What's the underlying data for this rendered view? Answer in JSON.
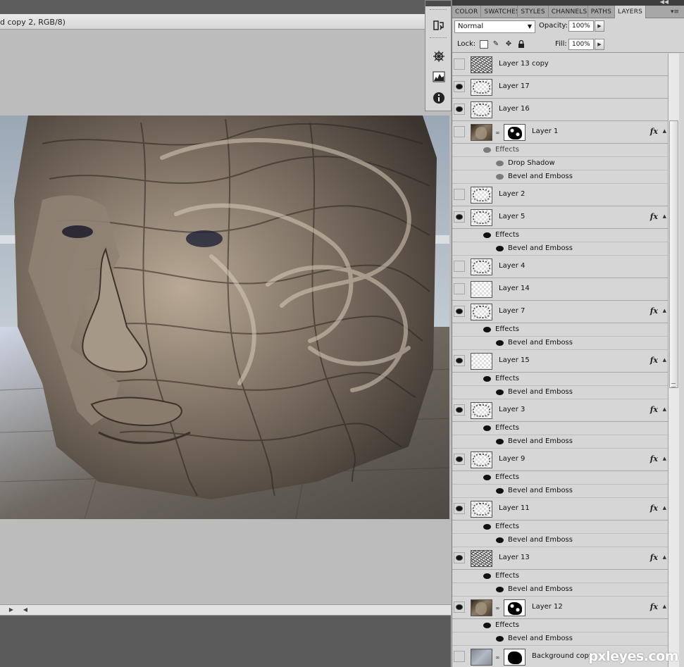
{
  "document": {
    "title": "d copy 2, RGB/8)",
    "artwork": "wireframe-face-sculpture"
  },
  "colors": {
    "panel_bg": "#d4d4d4",
    "canvas_bg": "#bcbcbc",
    "dark_chrome": "#3d3d3d"
  },
  "dock": {
    "icons": [
      "history-icon",
      "navigator-icon",
      "histogram-icon",
      "info-icon"
    ]
  },
  "panel": {
    "tabs": [
      {
        "label": "COLOR",
        "active": false
      },
      {
        "label": "SWATCHES",
        "active": false
      },
      {
        "label": "STYLES",
        "active": false
      },
      {
        "label": "CHANNELS",
        "active": false
      },
      {
        "label": "PATHS",
        "active": false
      },
      {
        "label": "LAYERS",
        "active": true
      }
    ],
    "blend_mode": "Normal",
    "opacity_label": "Opacity:",
    "opacity_value": "100%",
    "lock_label": "Lock:",
    "fill_label": "Fill:",
    "fill_value": "100%"
  },
  "layers": [
    {
      "name": "Layer 13 copy",
      "visible": false,
      "thumb": "dense",
      "mask": false,
      "fx": false,
      "effects": []
    },
    {
      "name": "Layer 17",
      "visible": true,
      "thumb": "sketch",
      "mask": false,
      "fx": false,
      "effects": []
    },
    {
      "name": "Layer 16",
      "visible": true,
      "thumb": "sketch",
      "mask": false,
      "fx": false,
      "effects": []
    },
    {
      "name": "Layer 1",
      "visible": false,
      "thumb": "photo",
      "mask": true,
      "fx": true,
      "effects_label": "Effects",
      "effects_dim": true,
      "effects": [
        "Drop Shadow",
        "Bevel and Emboss"
      ]
    },
    {
      "name": "Layer 2",
      "visible": false,
      "thumb": "sketch",
      "mask": false,
      "fx": false,
      "effects": []
    },
    {
      "name": "Layer 5",
      "visible": true,
      "thumb": "sketch",
      "mask": false,
      "fx": true,
      "effects_label": "Effects",
      "effects_dim": false,
      "effects": [
        "Bevel and Emboss"
      ]
    },
    {
      "name": "Layer 4",
      "visible": false,
      "thumb": "sketch",
      "mask": false,
      "fx": false,
      "effects": []
    },
    {
      "name": "Layer 14",
      "visible": false,
      "thumb": "checker",
      "mask": false,
      "fx": false,
      "effects": []
    },
    {
      "name": "Layer 7",
      "visible": true,
      "thumb": "sketch",
      "mask": false,
      "fx": true,
      "effects_label": "Effects",
      "effects_dim": false,
      "effects": [
        "Bevel and Emboss"
      ]
    },
    {
      "name": "Layer 15",
      "visible": true,
      "thumb": "checker",
      "mask": false,
      "fx": true,
      "effects_label": "Effects",
      "effects_dim": false,
      "effects": [
        "Bevel and Emboss"
      ]
    },
    {
      "name": "Layer 3",
      "visible": true,
      "thumb": "sketch",
      "mask": false,
      "fx": true,
      "effects_label": "Effects",
      "effects_dim": false,
      "effects": [
        "Bevel and Emboss"
      ]
    },
    {
      "name": "Layer 9",
      "visible": true,
      "thumb": "sketch",
      "mask": false,
      "fx": true,
      "effects_label": "Effects",
      "effects_dim": false,
      "effects": [
        "Bevel and Emboss"
      ]
    },
    {
      "name": "Layer 11",
      "visible": true,
      "thumb": "sketch",
      "mask": false,
      "fx": true,
      "effects_label": "Effects",
      "effects_dim": false,
      "effects": [
        "Bevel and Emboss"
      ]
    },
    {
      "name": "Layer 13",
      "visible": true,
      "thumb": "dense",
      "mask": false,
      "fx": true,
      "effects_label": "Effects",
      "effects_dim": false,
      "effects": [
        "Bevel and Emboss"
      ]
    },
    {
      "name": "Layer 12",
      "visible": true,
      "thumb": "photo",
      "mask": true,
      "fx": true,
      "effects_label": "Effects",
      "effects_dim": false,
      "effects": [
        "Bevel and Emboss"
      ]
    },
    {
      "name": "Background copy",
      "visible": false,
      "thumb": "bgphoto",
      "mask": true,
      "mask_style": "solid",
      "fx": false,
      "effects": []
    }
  ],
  "watermark": "pxleyes.com"
}
